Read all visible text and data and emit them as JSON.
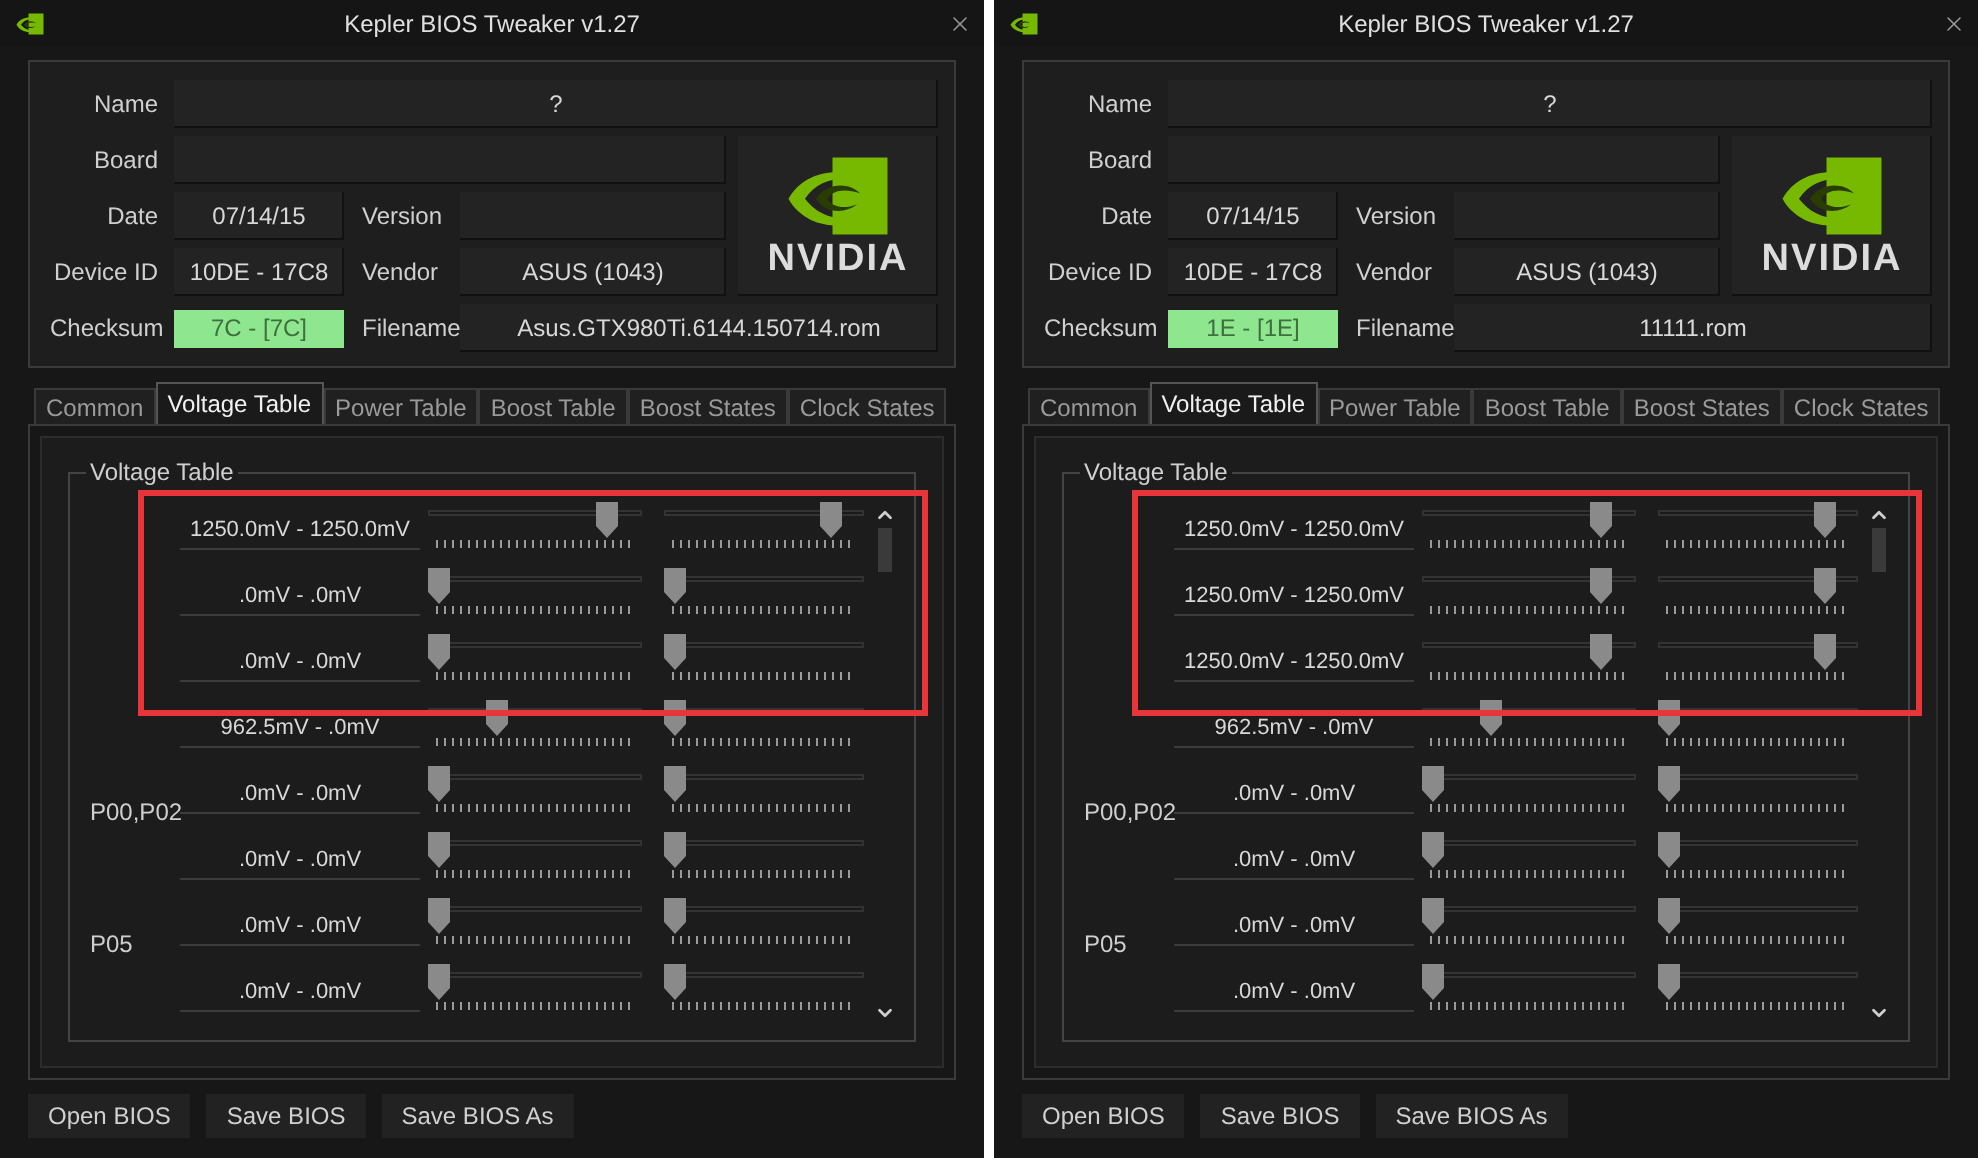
{
  "windows": [
    {
      "title": "Kepler BIOS Tweaker v1.27",
      "info": {
        "name": {
          "label": "Name",
          "value": "?"
        },
        "board": {
          "label": "Board"
        },
        "date": {
          "label": "Date",
          "value": "07/14/15"
        },
        "version": {
          "label": "Version"
        },
        "device_id": {
          "label": "Device ID",
          "value": "10DE - 17C8"
        },
        "vendor": {
          "label": "Vendor",
          "value": "ASUS (1043)"
        },
        "checksum": {
          "label": "Checksum",
          "value": "7C - [7C]",
          "valid": true
        },
        "filename": {
          "label": "Filename",
          "value": "Asus.GTX980Ti.6144.150714.rom"
        }
      },
      "logo_text": "NVIDIA",
      "tabs": [
        {
          "label": "Common",
          "selected": false
        },
        {
          "label": "Voltage Table",
          "selected": true
        },
        {
          "label": "Power Table",
          "selected": false
        },
        {
          "label": "Boost Table",
          "selected": false
        },
        {
          "label": "Boost States",
          "selected": false
        },
        {
          "label": "Clock States",
          "selected": false
        }
      ],
      "group_title": "Voltage Table",
      "rows": [
        {
          "voltage": "1250.0mV - 1250.0mV",
          "highlighted": true,
          "sliders": [
            {
              "level": 0.875
            },
            {
              "level": 0.88
            }
          ]
        },
        {
          "voltage": ".0mV - .0mV",
          "highlighted": true,
          "sliders": [
            {
              "level": 0
            },
            {
              "level": 0
            }
          ]
        },
        {
          "voltage": ".0mV - .0mV",
          "highlighted": true,
          "sliders": [
            {
              "level": 0
            },
            {
              "level": 0
            }
          ]
        },
        {
          "voltage": "962.5mV - .0mV",
          "highlighted": false,
          "sliders": [
            {
              "level": 0.3
            },
            {
              "level": 0
            }
          ]
        },
        {
          "label": "P00,P02",
          "voltage": ".0mV - .0mV",
          "highlighted": false,
          "sliders": [
            {
              "level": 0
            },
            {
              "level": 0
            }
          ]
        },
        {
          "voltage": ".0mV - .0mV",
          "highlighted": false,
          "sliders": [
            {
              "level": 0
            },
            {
              "level": 0
            }
          ]
        },
        {
          "label": "P05",
          "voltage": ".0mV - .0mV",
          "highlighted": false,
          "sliders": [
            {
              "level": 0
            },
            {
              "level": 0
            }
          ]
        },
        {
          "voltage": ".0mV - .0mV",
          "highlighted": false,
          "sliders": [
            {
              "level": 0
            },
            {
              "level": 0
            }
          ]
        }
      ],
      "buttons": [
        "Open BIOS",
        "Save BIOS",
        "Save BIOS As"
      ]
    },
    {
      "title": "Kepler BIOS Tweaker v1.27",
      "info": {
        "name": {
          "label": "Name",
          "value": "?"
        },
        "board": {
          "label": "Board"
        },
        "date": {
          "label": "Date",
          "value": "07/14/15"
        },
        "version": {
          "label": "Version"
        },
        "device_id": {
          "label": "Device ID",
          "value": "10DE - 17C8"
        },
        "vendor": {
          "label": "Vendor",
          "value": "ASUS (1043)"
        },
        "checksum": {
          "label": "Checksum",
          "value": "1E - [1E]",
          "valid": true
        },
        "filename": {
          "label": "Filename",
          "value": "11111.rom"
        }
      },
      "logo_text": "NVIDIA",
      "tabs": [
        {
          "label": "Common",
          "selected": false
        },
        {
          "label": "Voltage Table",
          "selected": true
        },
        {
          "label": "Power Table",
          "selected": false
        },
        {
          "label": "Boost Table",
          "selected": false
        },
        {
          "label": "Boost States",
          "selected": false
        },
        {
          "label": "Clock States",
          "selected": false
        }
      ],
      "group_title": "Voltage Table",
      "rows": [
        {
          "voltage": "1250.0mV - 1250.0mV",
          "highlighted": true,
          "sliders": [
            {
              "level": 0.875
            },
            {
              "level": 0.88
            }
          ]
        },
        {
          "voltage": "1250.0mV - 1250.0mV",
          "highlighted": true,
          "sliders": [
            {
              "level": 0.875
            },
            {
              "level": 0.88
            }
          ]
        },
        {
          "voltage": "1250.0mV - 1250.0mV",
          "highlighted": true,
          "sliders": [
            {
              "level": 0.875
            },
            {
              "level": 0.88
            }
          ]
        },
        {
          "voltage": "962.5mV - .0mV",
          "highlighted": false,
          "sliders": [
            {
              "level": 0.3
            },
            {
              "level": 0
            }
          ]
        },
        {
          "label": "P00,P02",
          "voltage": ".0mV - .0mV",
          "highlighted": false,
          "sliders": [
            {
              "level": 0
            },
            {
              "level": 0
            }
          ]
        },
        {
          "voltage": ".0mV - .0mV",
          "highlighted": false,
          "sliders": [
            {
              "level": 0
            },
            {
              "level": 0
            }
          ]
        },
        {
          "label": "P05",
          "voltage": ".0mV - .0mV",
          "highlighted": false,
          "sliders": [
            {
              "level": 0
            },
            {
              "level": 0
            }
          ]
        },
        {
          "voltage": ".0mV - .0mV",
          "highlighted": false,
          "sliders": [
            {
              "level": 0
            },
            {
              "level": 0
            }
          ]
        }
      ],
      "buttons": [
        "Open BIOS",
        "Save BIOS",
        "Save BIOS As"
      ]
    }
  ]
}
